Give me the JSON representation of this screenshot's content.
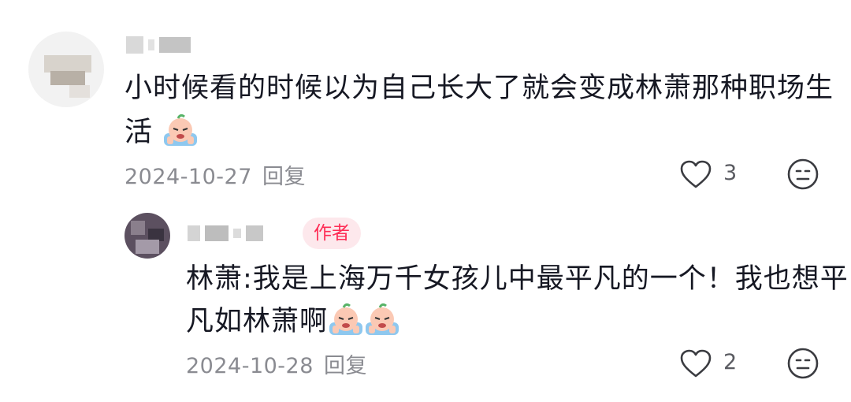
{
  "comments": [
    {
      "text_line1": "小时候看的时候以为自己长大了就会变成林萧那种职场生",
      "text_line2": "活",
      "emoji_count": 1,
      "date": "2024-10-27",
      "reply_label": "回复",
      "likes": "3",
      "icons": [
        "heart-icon",
        "dislike-face-icon",
        "crying-emoji"
      ]
    },
    {
      "author_badge": "作者",
      "text_line1": "林萧:我是上海万千女孩儿中最平凡的一个！我也想平",
      "text_line2": "凡如林萧啊",
      "emoji_count": 2,
      "date": "2024-10-28",
      "reply_label": "回复",
      "likes": "2",
      "icons": [
        "heart-icon",
        "dislike-face-icon",
        "crying-emoji"
      ]
    }
  ],
  "colors": {
    "text": "#161823",
    "meta": "#8a8b91",
    "badge_bg": "#fde8ec",
    "badge_text": "#fe2c55"
  }
}
